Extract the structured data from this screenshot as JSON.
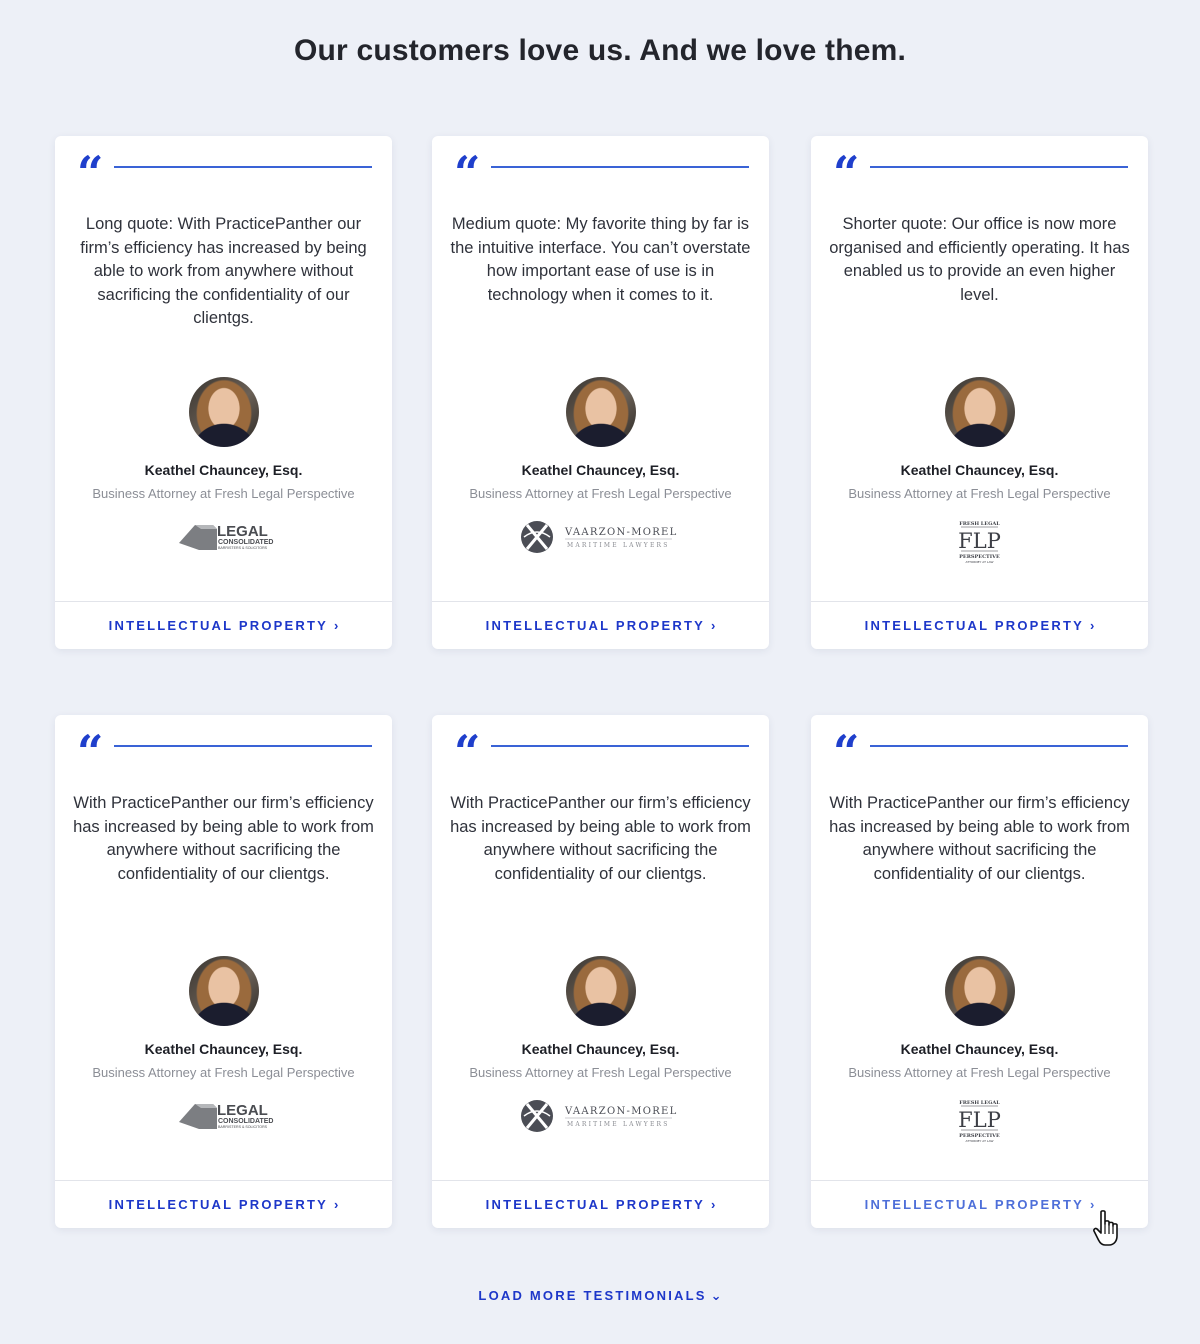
{
  "page": {
    "headline": "Our customers love us. And we love them.",
    "load_more_label": "LOAD MORE TESTIMONIALS",
    "colors": {
      "accent": "#1d37c9",
      "background": "#edf0f7"
    }
  },
  "cards": [
    {
      "quote_icon": "quote-open-icon",
      "quote": "Long quote: With PracticePanther our firm’s efficiency has increased by being able to work from anywhere without sacrificing the confidentiality of our clientgs.",
      "name": "Keathel Chauncey, Esq.",
      "title": "Business Attorney at Fresh Legal Perspective",
      "logo": {
        "kind": "legal-consolidated",
        "line1": "LEGAL",
        "line2": "CONSOLIDATED",
        "line3": "BARRISTERS & SOLICITORS"
      },
      "link_label": "INTELLECTUAL PROPERTY"
    },
    {
      "quote_icon": "quote-open-icon",
      "quote": "Medium quote: My favorite thing by far is the intuitive interface. You can’t overstate how important ease of use is in technology when it comes to it.",
      "name": "Keathel Chauncey, Esq.",
      "title": "Business Attorney at Fresh Legal Perspective",
      "logo": {
        "kind": "vaarzon-morel",
        "line1": "VAARZON-MOREL",
        "line2": "MARITIME LAWYERS"
      },
      "link_label": "INTELLECTUAL PROPERTY"
    },
    {
      "quote_icon": "quote-open-icon",
      "quote": "Shorter quote: Our office is now more organised and efficiently operating. It has enabled us to provide an even higher level.",
      "name": "Keathel Chauncey, Esq.",
      "title": "Business Attorney at Fresh Legal Perspective",
      "logo": {
        "kind": "flp",
        "line1": "FRESH LEGAL",
        "line2": "FLP",
        "line3": "PERSPECTIVE",
        "line4": "ATTORNEY AT LAW"
      },
      "link_label": "INTELLECTUAL PROPERTY"
    },
    {
      "quote_icon": "quote-open-icon",
      "quote": "With PracticePanther our firm’s efficiency has increased by being able to work from anywhere without sacrificing the confidentiality of our clientgs.",
      "name": "Keathel Chauncey, Esq.",
      "title": "Business Attorney at Fresh Legal Perspective",
      "logo": {
        "kind": "legal-consolidated",
        "line1": "LEGAL",
        "line2": "CONSOLIDATED",
        "line3": "BARRISTERS & SOLICITORS"
      },
      "link_label": "INTELLECTUAL PROPERTY"
    },
    {
      "quote_icon": "quote-open-icon",
      "quote": "With PracticePanther our firm’s efficiency has increased by being able to work from anywhere without sacrificing the confidentiality of our clientgs.",
      "name": "Keathel Chauncey, Esq.",
      "title": "Business Attorney at Fresh Legal Perspective",
      "logo": {
        "kind": "vaarzon-morel",
        "line1": "VAARZON-MOREL",
        "line2": "MARITIME LAWYERS"
      },
      "link_label": "INTELLECTUAL PROPERTY"
    },
    {
      "quote_icon": "quote-open-icon",
      "quote": "With PracticePanther our firm’s efficiency has increased by being able to work from anywhere without sacrificing the confidentiality of our clientgs.",
      "name": "Keathel Chauncey, Esq.",
      "title": "Business Attorney at Fresh Legal Perspective",
      "logo": {
        "kind": "flp",
        "line1": "FRESH LEGAL",
        "line2": "FLP",
        "line3": "PERSPECTIVE",
        "line4": "ATTORNEY AT LAW"
      },
      "link_label": "INTELLECTUAL PROPERTY",
      "hovered": true
    }
  ]
}
